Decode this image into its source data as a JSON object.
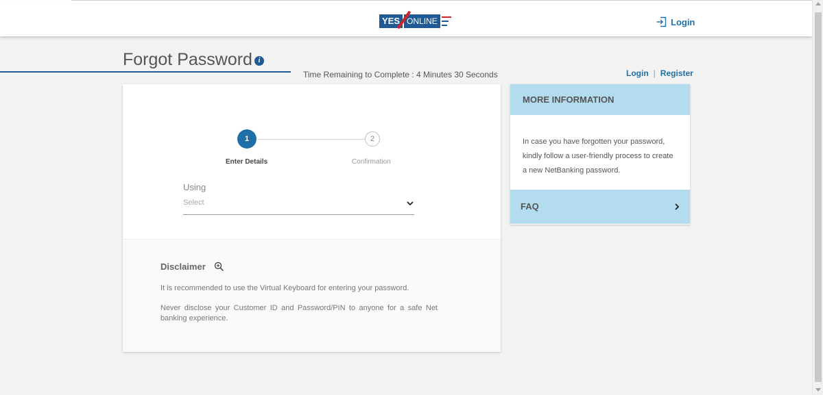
{
  "header": {
    "logo_yes": "YES",
    "logo_online": "ONLINE",
    "login_label": "Login"
  },
  "page": {
    "title": "Forgot Password",
    "timer": "Time Remaining to Complete : 4 Minutes 30 Seconds",
    "links": {
      "login": "Login",
      "separator": "|",
      "register": "Register"
    }
  },
  "stepper": {
    "steps": [
      {
        "number": "1",
        "label": "Enter Details",
        "active": true
      },
      {
        "number": "2",
        "label": "Confirmation",
        "active": false
      }
    ]
  },
  "form": {
    "using_label": "Using",
    "select_value": "Select"
  },
  "disclaimer": {
    "title": "Disclaimer",
    "line1": "It is recommended to use the Virtual Keyboard for entering your password.",
    "line2": "Never disclose your Customer ID and Password/PIN to anyone for a safe Net banking experience."
  },
  "sidebar": {
    "more_info_title": "MORE INFORMATION",
    "more_info_text": "In case you have forgotten your password, kindly follow a user-friendly process to create a new NetBanking password.",
    "faq_label": "FAQ"
  },
  "colors": {
    "brand_blue": "#1f5a94",
    "link_blue": "#1f6fa9",
    "panel_blue": "#b3dcee",
    "brand_red": "#d0232a"
  }
}
